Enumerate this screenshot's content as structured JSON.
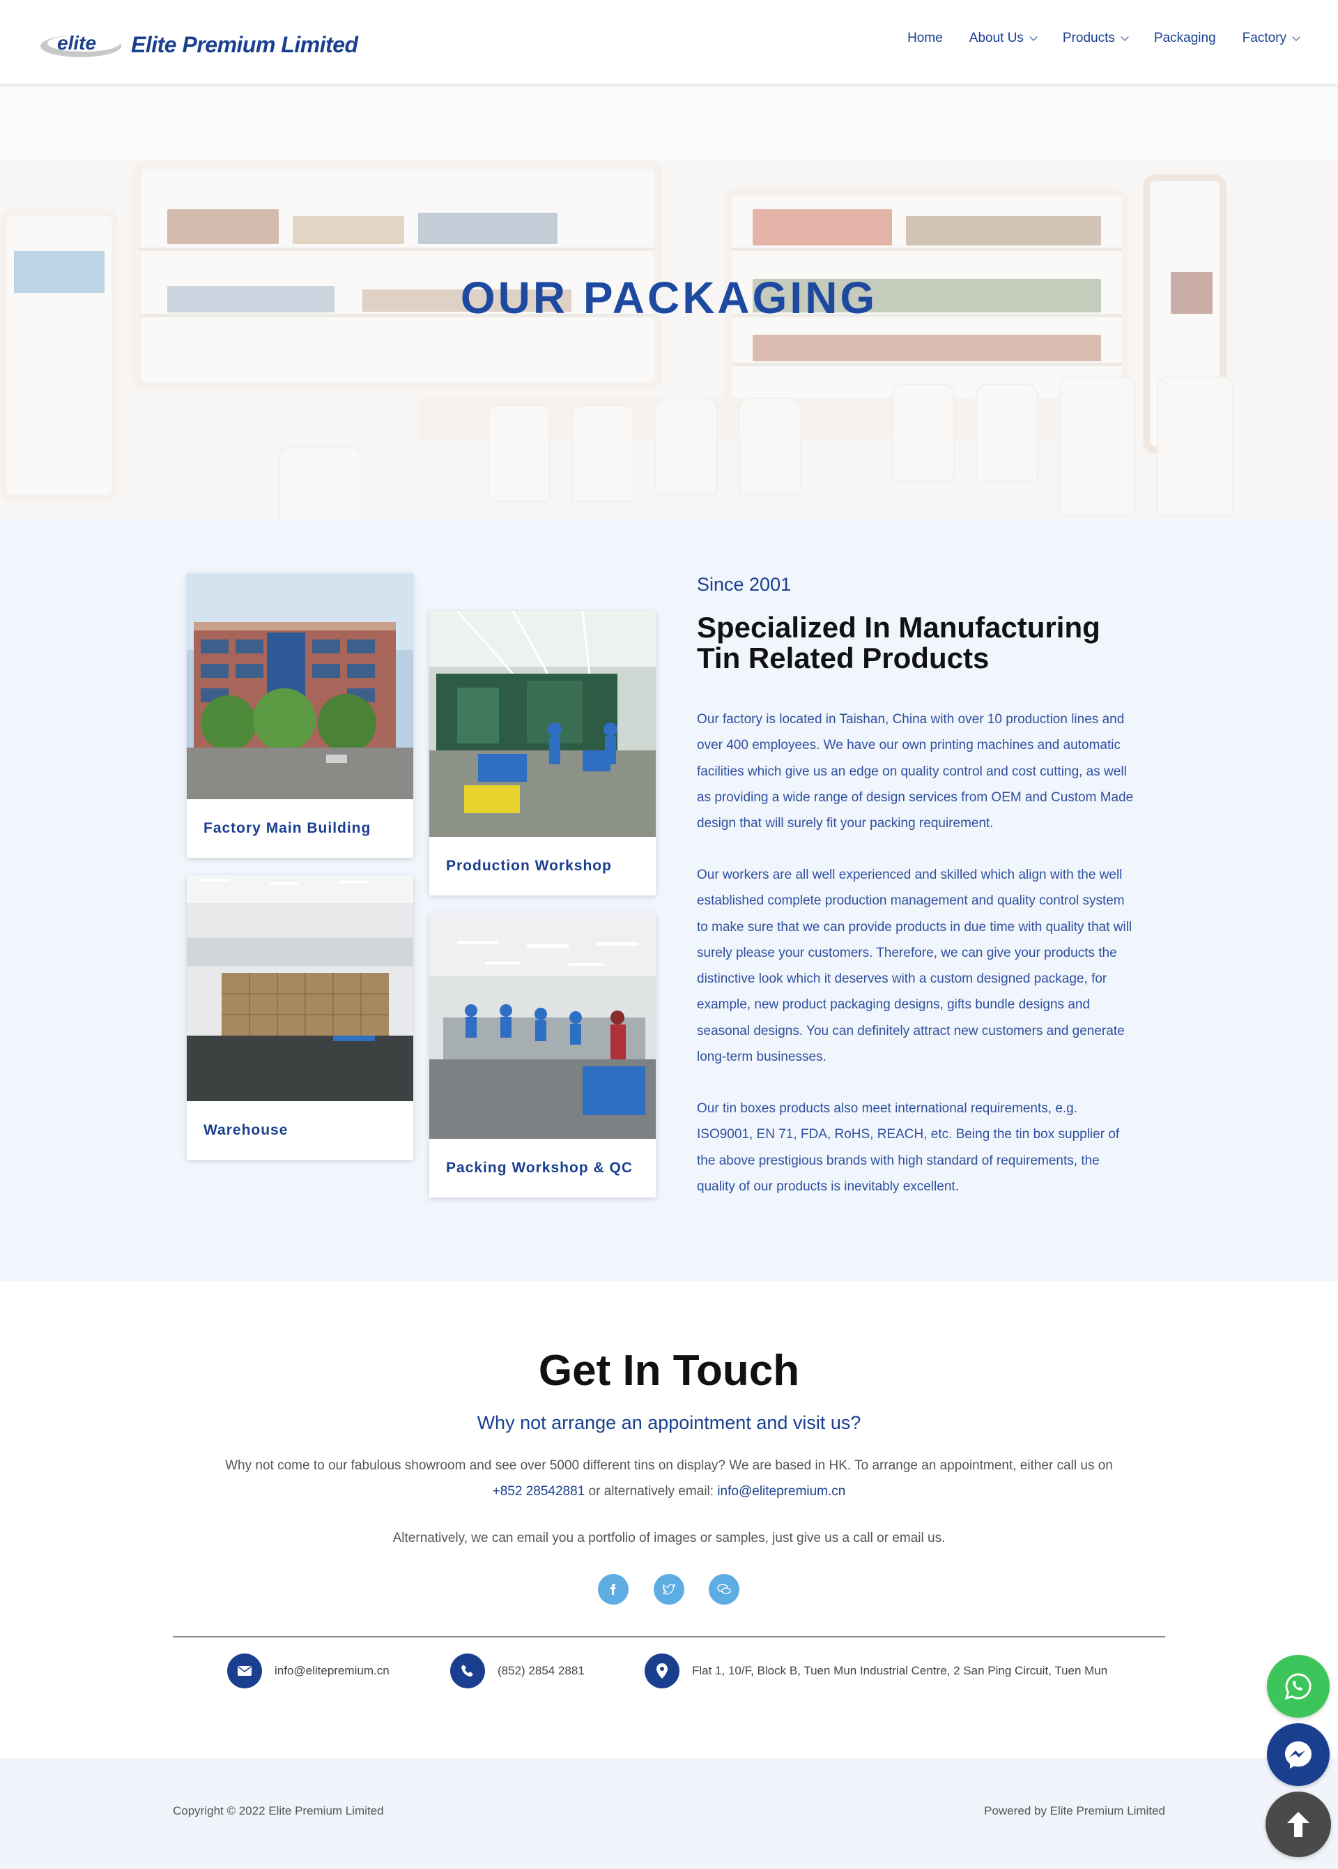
{
  "header": {
    "brand": "Elite Premium Limited",
    "logo_word": "elite",
    "nav": [
      {
        "label": "Home",
        "dropdown": false
      },
      {
        "label": "About Us",
        "dropdown": true
      },
      {
        "label": "Products",
        "dropdown": true
      },
      {
        "label": "Packaging",
        "dropdown": false
      },
      {
        "label": "Factory",
        "dropdown": true
      }
    ]
  },
  "hero": {
    "title": "OUR PACKAGING"
  },
  "gallery": [
    {
      "caption": "Factory Main Building"
    },
    {
      "caption": "Production Workshop"
    },
    {
      "caption": "Warehouse"
    },
    {
      "caption": "Packing Workshop & QC"
    }
  ],
  "about": {
    "since": "Since 2001",
    "heading": "Specialized In Manufacturing Tin Related Products",
    "paragraphs": [
      "Our factory is located in Taishan, China with over 10 production lines and over 400 employees. We have our own printing machines and automatic facilities which give us an edge on quality control and cost cutting, as well as providing a wide range of design services from OEM and Custom Made design that will surely fit your packing requirement.",
      "Our workers are all well experienced and skilled which align with the well established complete production management and quality control system to make sure that we can provide products in due time with quality that will surely please your customers. Therefore, we can give your products the distinctive look which it deserves with a custom designed package, for example, new product packaging designs, gifts bundle designs and seasonal designs. You can definitely attract new customers and generate long-term businesses.",
      "Our tin boxes products also meet international requirements, e.g. ISO9001, EN 71, FDA, RoHS, REACH, etc. Being the tin box supplier of the above prestigious brands with high standard of requirements, the quality of our products is inevitably excellent."
    ]
  },
  "contact": {
    "title": "Get In Touch",
    "subtitle": "Why not arrange an appointment and visit us?",
    "text_before": "Why not come to our fabulous showroom and see over 5000 different tins on display? We are based in HK. To arrange an appointment, either call us on ",
    "phone_link": "+852 28542881",
    "text_middle": " or alternatively email: ",
    "email_link": "info@elitepremium.cn",
    "alt_text": "Alternatively, we can email you a portfolio of images or samples, just give us a call or email us.",
    "social_icons": [
      "facebook-icon",
      "twitter-icon",
      "chat-icon"
    ],
    "info": {
      "email": "info@elitepremium.cn",
      "phone": "(852) 2854 2881",
      "address": "Flat 1, 10/F, Block B, Tuen Mun Industrial Centre, 2 San Ping Circuit, Tuen Mun"
    }
  },
  "footer": {
    "copyright": "Copyright © 2022 Elite Premium Limited",
    "powered": "Powered by Elite Premium Limited"
  },
  "colors": {
    "brand_blue": "#1a3f8f",
    "section_bg": "#f1f6fd",
    "whatsapp": "#3cc55a",
    "messenger": "#1a3f8f",
    "scroll_top": "#4a4a4a",
    "social": "#5dade2"
  }
}
